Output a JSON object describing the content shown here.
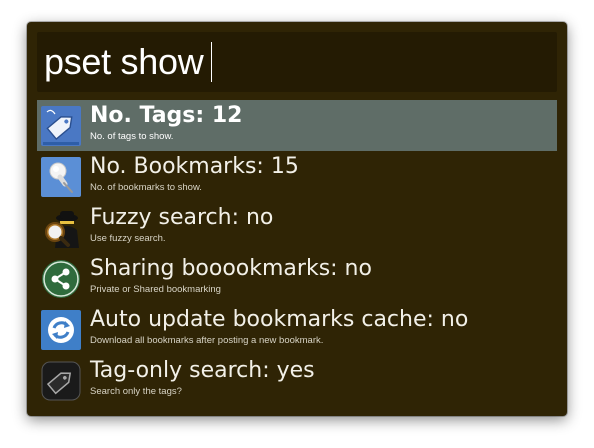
{
  "search": {
    "query": "pset show"
  },
  "results": [
    {
      "title": "No. Tags: 12",
      "subtitle": "No. of tags to show.",
      "icon": "tag-icon",
      "selected": true
    },
    {
      "title": "No. Bookmarks: 15",
      "subtitle": "No. of bookmarks to show.",
      "icon": "pushpin-icon",
      "selected": false
    },
    {
      "title": "Fuzzy search: no",
      "subtitle": "Use fuzzy search.",
      "icon": "spy-magnifier-icon",
      "selected": false
    },
    {
      "title": "Sharing booookmarks: no",
      "subtitle": "Private or Shared bookmarking",
      "icon": "share-icon",
      "selected": false
    },
    {
      "title": "Auto update bookmarks cache: no",
      "subtitle": "Download all bookmarks after posting a new bookmark.",
      "icon": "refresh-icon",
      "selected": false
    },
    {
      "title": "Tag-only search: yes",
      "subtitle": "Search only the tags?",
      "icon": "tag-dark-icon",
      "selected": false
    }
  ],
  "colors": {
    "window_background": "#2f2405",
    "query_background": "#241b03",
    "selection_background": "#5f6d67",
    "text": "#ffffff"
  }
}
